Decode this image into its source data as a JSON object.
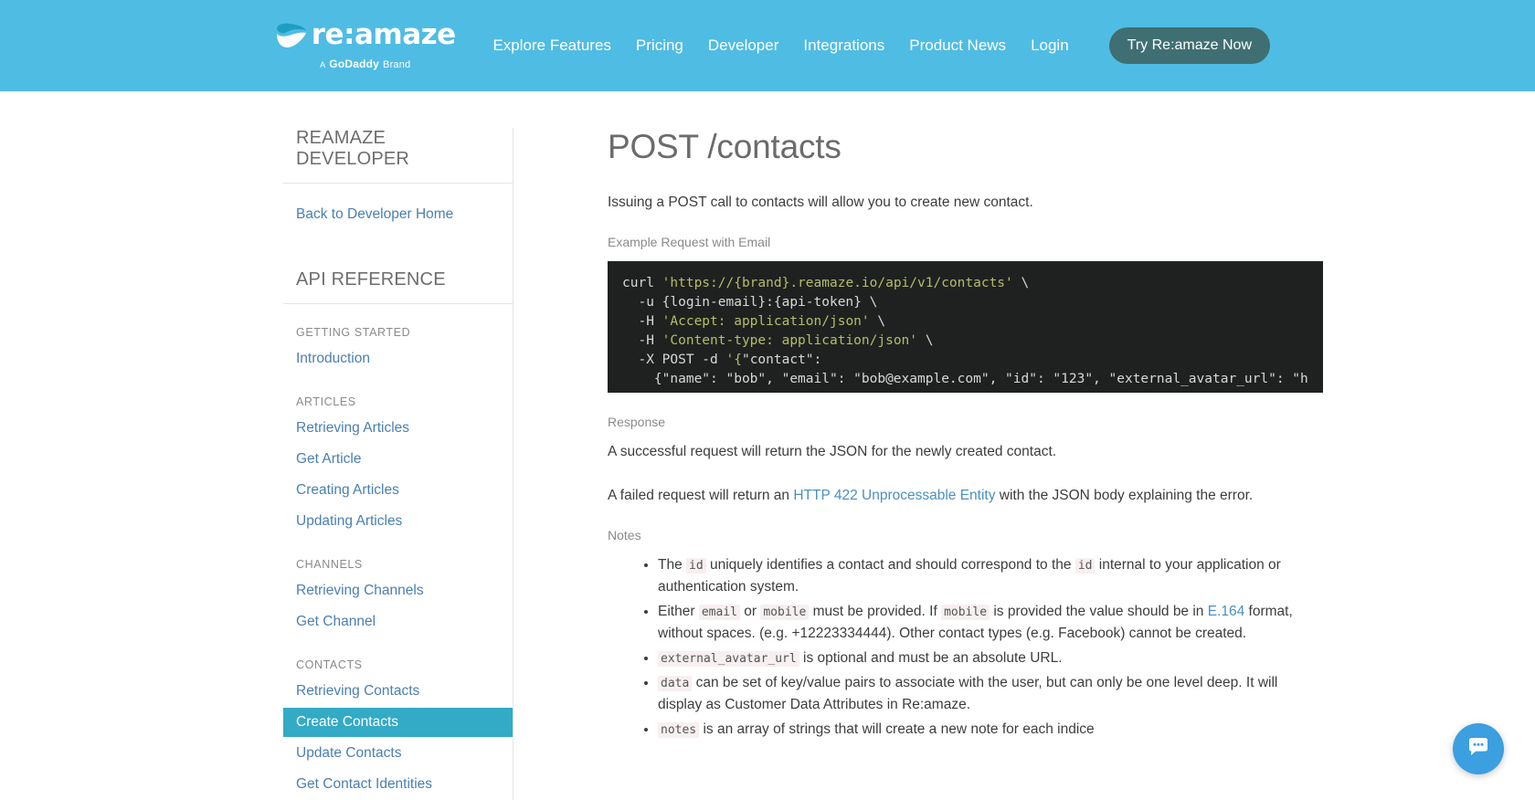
{
  "header": {
    "brand_name": "re:amaze",
    "brand_tagline_a": "A",
    "brand_tagline_godaddy": "GoDaddy",
    "brand_tagline_brand": "Brand",
    "nav": [
      {
        "label": "Explore Features"
      },
      {
        "label": "Pricing"
      },
      {
        "label": "Developer"
      },
      {
        "label": "Integrations"
      },
      {
        "label": "Product News"
      },
      {
        "label": "Login"
      }
    ],
    "cta_label": "Try Re:amaze Now",
    "background_color": "#4fbce4",
    "cta_color": "#3f6f72"
  },
  "sidebar": {
    "title": "REAMAZE DEVELOPER",
    "back_link": "Back to Developer Home",
    "api_reference_title": "API REFERENCE",
    "groups": [
      {
        "label": "GETTING STARTED",
        "items": [
          {
            "label": "Introduction",
            "active": false
          }
        ]
      },
      {
        "label": "ARTICLES",
        "items": [
          {
            "label": "Retrieving Articles",
            "active": false
          },
          {
            "label": "Get Article",
            "active": false
          },
          {
            "label": "Creating Articles",
            "active": false
          },
          {
            "label": "Updating Articles",
            "active": false
          }
        ]
      },
      {
        "label": "CHANNELS",
        "items": [
          {
            "label": "Retrieving Channels",
            "active": false
          },
          {
            "label": "Get Channel",
            "active": false
          }
        ]
      },
      {
        "label": "CONTACTS",
        "items": [
          {
            "label": "Retrieving Contacts",
            "active": false
          },
          {
            "label": "Create Contacts",
            "active": true
          },
          {
            "label": "Update Contacts",
            "active": false
          },
          {
            "label": "Get Contact Identities",
            "active": false
          }
        ]
      }
    ],
    "active_color": "#33aac6",
    "link_color": "#4a7fb0"
  },
  "main": {
    "title": "POST /contacts",
    "intro": "Issuing a POST call to contacts will allow you to create new contact.",
    "example_label": "Example Request with Email",
    "code": {
      "line1_cmd": "curl ",
      "line1_str": "'https://{brand}.reamaze.io/api/v1/contacts'",
      "line1_tail": " \\",
      "line2": "  -u {login-email}:{api-token} \\",
      "line3_cmd": "  -H ",
      "line3_str": "'Accept: application/json'",
      "line3_tail": " \\",
      "line4_cmd": "  -H ",
      "line4_str": "'Content-type: application/json'",
      "line4_tail": " \\",
      "line5_cmd": "  -X POST -d ",
      "line5_str": "'{",
      "line5_tail": "\"contact\":",
      "line6": "    {\"name\": \"bob\", \"email\": \"bob@example.com\", \"id\": \"123\", \"external_avatar_url\": \"h"
    },
    "response_label": "Response",
    "response_success": "A successful request will return the JSON for the newly created contact.",
    "response_fail_prefix": "A failed request will return an ",
    "response_fail_link": "HTTP 422 Unprocessable Entity",
    "response_fail_suffix": " with the JSON body explaining the error.",
    "notes_label": "Notes",
    "notes": [
      {
        "part1": "The ",
        "code1": "id",
        "part2": " uniquely identifies a contact and should correspond to the ",
        "code2": "id",
        "part3": " internal to your application or authentication system."
      },
      {
        "part1": "Either ",
        "code1": "email",
        "part2": " or ",
        "code2": "mobile",
        "part3": " must be provided. If ",
        "code3": "mobile",
        "part4": " is provided the value should be in ",
        "link": "E.164",
        "part5": " format, without spaces. (e.g. +12223334444). Other contact types (e.g. Facebook) cannot be created."
      },
      {
        "code1": "external_avatar_url",
        "part1": " is optional and must be an absolute URL."
      },
      {
        "code1": "data",
        "part1": " can be set of key/value pairs to associate with the user, but can only be one level deep. It will display as Customer Data Attributes in Re:amaze."
      },
      {
        "code1": "notes",
        "part1": " is an array of strings that will create a new note for each indice"
      }
    ]
  },
  "chat_widget": {
    "name": "chat-bubble",
    "color": "#3b9fe0"
  }
}
